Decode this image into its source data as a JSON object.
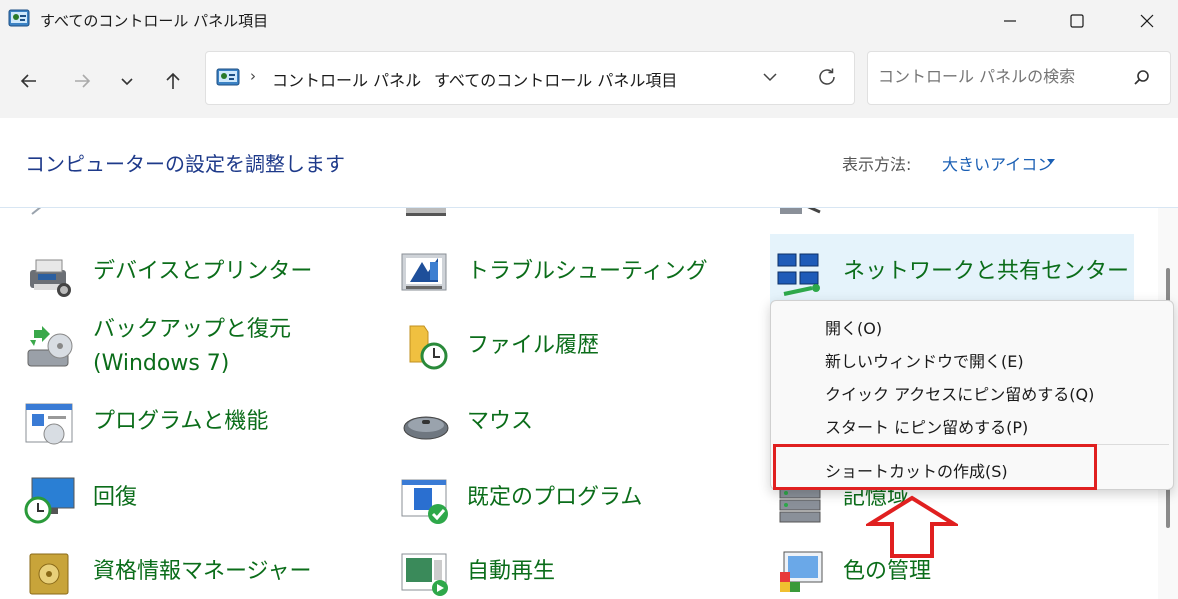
{
  "window": {
    "title": "すべてのコントロール パネル項目"
  },
  "nav": {
    "breadcrumb": [
      "コントロール パネル",
      "すべてのコントロール パネル項目"
    ],
    "separator": "›",
    "search_placeholder": "コントロール パネルの検索"
  },
  "header": {
    "title": "コンピューターの設定を調整します",
    "view_label": "表示方法:",
    "view_value": "大きいアイコン"
  },
  "items": [
    {
      "label": "デバイスとプリンター",
      "icon": "printer-icon"
    },
    {
      "label": "トラブルシューティング",
      "icon": "troubleshoot-icon"
    },
    {
      "label": "ネットワークと共有センター",
      "icon": "network-icon",
      "highlighted": true
    },
    {
      "label": "バックアップと復元",
      "label2": "(Windows 7)",
      "icon": "backup-icon"
    },
    {
      "label": "ファイル履歴",
      "icon": "file-history-icon"
    },
    {
      "label": "プログラムと機能",
      "icon": "programs-icon"
    },
    {
      "label": "マウス",
      "icon": "mouse-icon"
    },
    {
      "label": "回復",
      "icon": "recovery-icon"
    },
    {
      "label": "既定のプログラム",
      "icon": "default-programs-icon"
    },
    {
      "label": "記憶域",
      "icon": "storage-icon"
    },
    {
      "label": "資格情報マネージャー",
      "icon": "credential-icon"
    },
    {
      "label": "自動再生",
      "icon": "autoplay-icon"
    },
    {
      "label": "色の管理",
      "icon": "color-management-icon"
    }
  ],
  "context_menu": {
    "items": [
      "開く(O)",
      "新しいウィンドウで開く(E)",
      "クイック アクセスにピン留めする(Q)",
      "スタート にピン留めする(P)",
      "ショートカットの作成(S)"
    ]
  },
  "colors": {
    "link_green": "#0b6d1a",
    "title_blue": "#1e3a8a",
    "accent_blue": "#1a5fb4",
    "annotation_red": "#e02020",
    "hover_bg": "#e5f3fb"
  }
}
